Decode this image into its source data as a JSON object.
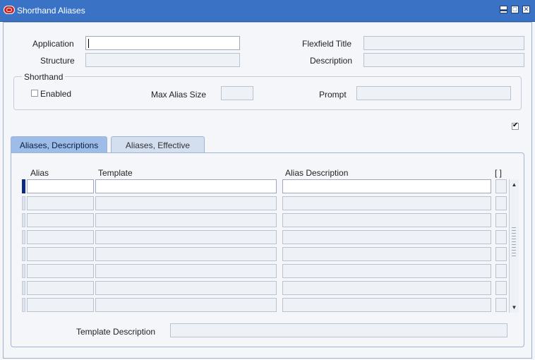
{
  "window": {
    "title": "Shorthand Aliases",
    "controls": {
      "minimize": "▬",
      "maximize": "□",
      "close": "✕"
    }
  },
  "header": {
    "application_label": "Application",
    "structure_label": "Structure",
    "flexfield_title_label": "Flexfield Title",
    "description_label": "Description",
    "application_value": "",
    "structure_value": "",
    "flexfield_title_value": "",
    "description_value": ""
  },
  "shorthand": {
    "group_title": "Shorthand",
    "enabled_label": "Enabled",
    "enabled_checked": false,
    "max_alias_size_label": "Max Alias Size",
    "max_alias_size_value": "",
    "prompt_label": "Prompt",
    "prompt_value": ""
  },
  "standalone_checkbox_checked": true,
  "tabs": [
    {
      "label": "Aliases, Descriptions",
      "selected": true
    },
    {
      "label": "Aliases, Effective",
      "selected": false
    }
  ],
  "table": {
    "columns": {
      "alias": "Alias",
      "template": "Template",
      "alias_description": "Alias Description",
      "dff": "[ ]"
    },
    "row_count": 8,
    "scroll": {
      "up": "▲",
      "down": "▼"
    }
  },
  "footer": {
    "template_description_label": "Template Description",
    "template_description_value": ""
  },
  "colors": {
    "title_bar": "#3a73c6",
    "tab_selected": "#9dbde8",
    "tab_unselected": "#d3deef",
    "current_row_marker": "#0c2b80"
  }
}
